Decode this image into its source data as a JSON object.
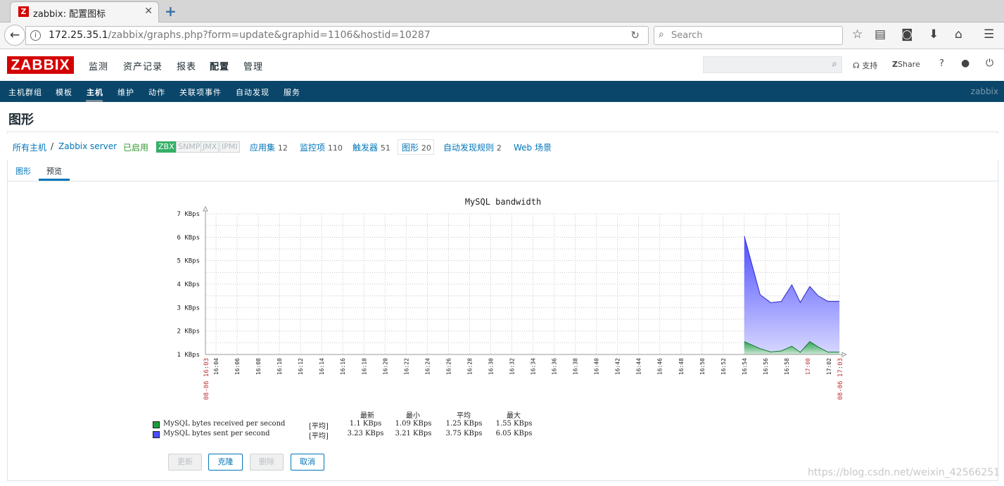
{
  "browser": {
    "tab_title": "zabbix: 配置图标",
    "favicon_letter": "Z",
    "url_host": "172.25.35.1",
    "url_rest": "/zabbix/graphs.php?form=update&graphid=1106&hostid=10287",
    "search_placeholder": "Search"
  },
  "header": {
    "logo": "ZABBIX",
    "menu": [
      "监测",
      "资产记录",
      "报表",
      "配置",
      "管理"
    ],
    "active_menu": "配置",
    "support_label": "支持",
    "share_label": "Share",
    "help_label": "?"
  },
  "submenu": {
    "items": [
      "主机群组",
      "模板",
      "主机",
      "维护",
      "动作",
      "关联项事件",
      "自动发现",
      "服务"
    ],
    "active": "主机",
    "right_label": "zabbix"
  },
  "page": {
    "title": "图形"
  },
  "hostbar": {
    "all_hosts": "所有主机",
    "separator": "/",
    "host": "Zabbix server",
    "enabled": "已启用",
    "badges": [
      "ZBX",
      "SNMP",
      "JMX",
      "IPMI"
    ],
    "applications_label": "应用集",
    "applications_count": "12",
    "items_label": "监控项",
    "items_count": "110",
    "triggers_label": "触发器",
    "triggers_count": "51",
    "graphs_label": "图形",
    "graphs_count": "20",
    "discovery_label": "自动发现规则",
    "discovery_count": "2",
    "web_label": "Web 场景"
  },
  "tabs": {
    "graph": "图形",
    "preview": "预览"
  },
  "chart_data": {
    "type": "area",
    "title": "MySQL bandwidth",
    "y_ticks": [
      "1 KBps",
      "2 KBps",
      "3 KBps",
      "4 KBps",
      "5 KBps",
      "6 KBps",
      "7 KBps"
    ],
    "ylim": [
      1,
      7
    ],
    "x_start_label": "08-06 16:03",
    "x_end_label": "08-06 17:03",
    "x_ticks": [
      "16:04",
      "16:06",
      "16:08",
      "16:10",
      "16:12",
      "16:14",
      "16:16",
      "16:18",
      "16:20",
      "16:22",
      "16:24",
      "16:26",
      "16:28",
      "16:30",
      "16:32",
      "16:34",
      "16:36",
      "16:38",
      "16:40",
      "16:42",
      "16:44",
      "16:46",
      "16:48",
      "16:50",
      "16:52",
      "16:54",
      "16:56",
      "16:58",
      "17:00",
      "17:02"
    ],
    "x_tick_minutes": [
      1,
      3,
      5,
      7,
      9,
      11,
      13,
      15,
      17,
      19,
      21,
      23,
      25,
      27,
      29,
      31,
      33,
      35,
      37,
      39,
      41,
      43,
      45,
      47,
      49,
      51,
      53,
      55,
      57,
      59
    ],
    "highlight_ticks": [
      "17:00"
    ],
    "x_minutes_total": 60,
    "series": [
      {
        "name": "MySQL bytes sent per second",
        "color": "#4c4cff",
        "x": [
          51,
          52.5,
          53.5,
          54.5,
          55.5,
          56.3,
          57.2,
          58,
          58.9,
          59.6,
          60
        ],
        "y": [
          6.05,
          3.55,
          3.21,
          3.26,
          3.97,
          3.22,
          3.9,
          3.5,
          3.27,
          3.27,
          3.27
        ]
      },
      {
        "name": "MySQL bytes received per second",
        "color": "#1a9e3c",
        "x": [
          51,
          52.5,
          53.5,
          54.5,
          55.5,
          56.3,
          57.2,
          58,
          58.9,
          59.6,
          60
        ],
        "y": [
          1.55,
          1.25,
          1.11,
          1.15,
          1.35,
          1.09,
          1.55,
          1.32,
          1.1,
          1.1,
          1.1
        ]
      }
    ],
    "legend": {
      "headers": [
        "最新",
        "最小",
        "平均",
        "最大"
      ],
      "rows": [
        {
          "color": "#1a9e3c",
          "name": "MySQL bytes received per second",
          "func": "[平均]",
          "last": "1.1 KBps",
          "min": "1.09 KBps",
          "avg": "1.25 KBps",
          "max": "1.55 KBps"
        },
        {
          "color": "#4c4cff",
          "name": "MySQL bytes sent per second",
          "func": "[平均]",
          "last": "3.23 KBps",
          "min": "3.21 KBps",
          "avg": "3.75 KBps",
          "max": "6.05 KBps"
        }
      ]
    }
  },
  "buttons": {
    "update": "更新",
    "clone": "克隆",
    "delete": "删除",
    "cancel": "取消"
  },
  "watermark": "https://blog.csdn.net/weixin_42566251"
}
